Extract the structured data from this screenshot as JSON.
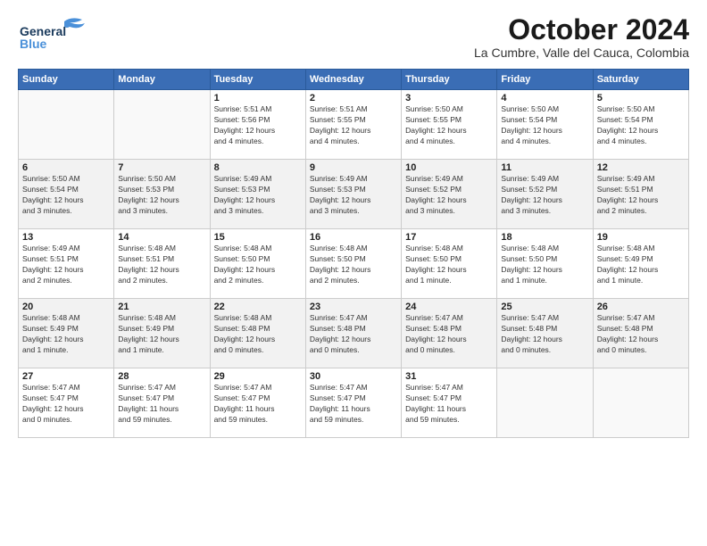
{
  "logo": {
    "line1": "General",
    "line2": "Blue"
  },
  "title": "October 2024",
  "location": "La Cumbre, Valle del Cauca, Colombia",
  "days_header": [
    "Sunday",
    "Monday",
    "Tuesday",
    "Wednesday",
    "Thursday",
    "Friday",
    "Saturday"
  ],
  "weeks": [
    [
      {
        "num": "",
        "info": ""
      },
      {
        "num": "",
        "info": ""
      },
      {
        "num": "1",
        "info": "Sunrise: 5:51 AM\nSunset: 5:56 PM\nDaylight: 12 hours\nand 4 minutes."
      },
      {
        "num": "2",
        "info": "Sunrise: 5:51 AM\nSunset: 5:55 PM\nDaylight: 12 hours\nand 4 minutes."
      },
      {
        "num": "3",
        "info": "Sunrise: 5:50 AM\nSunset: 5:55 PM\nDaylight: 12 hours\nand 4 minutes."
      },
      {
        "num": "4",
        "info": "Sunrise: 5:50 AM\nSunset: 5:54 PM\nDaylight: 12 hours\nand 4 minutes."
      },
      {
        "num": "5",
        "info": "Sunrise: 5:50 AM\nSunset: 5:54 PM\nDaylight: 12 hours\nand 4 minutes."
      }
    ],
    [
      {
        "num": "6",
        "info": "Sunrise: 5:50 AM\nSunset: 5:54 PM\nDaylight: 12 hours\nand 3 minutes."
      },
      {
        "num": "7",
        "info": "Sunrise: 5:50 AM\nSunset: 5:53 PM\nDaylight: 12 hours\nand 3 minutes."
      },
      {
        "num": "8",
        "info": "Sunrise: 5:49 AM\nSunset: 5:53 PM\nDaylight: 12 hours\nand 3 minutes."
      },
      {
        "num": "9",
        "info": "Sunrise: 5:49 AM\nSunset: 5:53 PM\nDaylight: 12 hours\nand 3 minutes."
      },
      {
        "num": "10",
        "info": "Sunrise: 5:49 AM\nSunset: 5:52 PM\nDaylight: 12 hours\nand 3 minutes."
      },
      {
        "num": "11",
        "info": "Sunrise: 5:49 AM\nSunset: 5:52 PM\nDaylight: 12 hours\nand 3 minutes."
      },
      {
        "num": "12",
        "info": "Sunrise: 5:49 AM\nSunset: 5:51 PM\nDaylight: 12 hours\nand 2 minutes."
      }
    ],
    [
      {
        "num": "13",
        "info": "Sunrise: 5:49 AM\nSunset: 5:51 PM\nDaylight: 12 hours\nand 2 minutes."
      },
      {
        "num": "14",
        "info": "Sunrise: 5:48 AM\nSunset: 5:51 PM\nDaylight: 12 hours\nand 2 minutes."
      },
      {
        "num": "15",
        "info": "Sunrise: 5:48 AM\nSunset: 5:50 PM\nDaylight: 12 hours\nand 2 minutes."
      },
      {
        "num": "16",
        "info": "Sunrise: 5:48 AM\nSunset: 5:50 PM\nDaylight: 12 hours\nand 2 minutes."
      },
      {
        "num": "17",
        "info": "Sunrise: 5:48 AM\nSunset: 5:50 PM\nDaylight: 12 hours\nand 1 minute."
      },
      {
        "num": "18",
        "info": "Sunrise: 5:48 AM\nSunset: 5:50 PM\nDaylight: 12 hours\nand 1 minute."
      },
      {
        "num": "19",
        "info": "Sunrise: 5:48 AM\nSunset: 5:49 PM\nDaylight: 12 hours\nand 1 minute."
      }
    ],
    [
      {
        "num": "20",
        "info": "Sunrise: 5:48 AM\nSunset: 5:49 PM\nDaylight: 12 hours\nand 1 minute."
      },
      {
        "num": "21",
        "info": "Sunrise: 5:48 AM\nSunset: 5:49 PM\nDaylight: 12 hours\nand 1 minute."
      },
      {
        "num": "22",
        "info": "Sunrise: 5:48 AM\nSunset: 5:48 PM\nDaylight: 12 hours\nand 0 minutes."
      },
      {
        "num": "23",
        "info": "Sunrise: 5:47 AM\nSunset: 5:48 PM\nDaylight: 12 hours\nand 0 minutes."
      },
      {
        "num": "24",
        "info": "Sunrise: 5:47 AM\nSunset: 5:48 PM\nDaylight: 12 hours\nand 0 minutes."
      },
      {
        "num": "25",
        "info": "Sunrise: 5:47 AM\nSunset: 5:48 PM\nDaylight: 12 hours\nand 0 minutes."
      },
      {
        "num": "26",
        "info": "Sunrise: 5:47 AM\nSunset: 5:48 PM\nDaylight: 12 hours\nand 0 minutes."
      }
    ],
    [
      {
        "num": "27",
        "info": "Sunrise: 5:47 AM\nSunset: 5:47 PM\nDaylight: 12 hours\nand 0 minutes."
      },
      {
        "num": "28",
        "info": "Sunrise: 5:47 AM\nSunset: 5:47 PM\nDaylight: 11 hours\nand 59 minutes."
      },
      {
        "num": "29",
        "info": "Sunrise: 5:47 AM\nSunset: 5:47 PM\nDaylight: 11 hours\nand 59 minutes."
      },
      {
        "num": "30",
        "info": "Sunrise: 5:47 AM\nSunset: 5:47 PM\nDaylight: 11 hours\nand 59 minutes."
      },
      {
        "num": "31",
        "info": "Sunrise: 5:47 AM\nSunset: 5:47 PM\nDaylight: 11 hours\nand 59 minutes."
      },
      {
        "num": "",
        "info": ""
      },
      {
        "num": "",
        "info": ""
      }
    ]
  ]
}
